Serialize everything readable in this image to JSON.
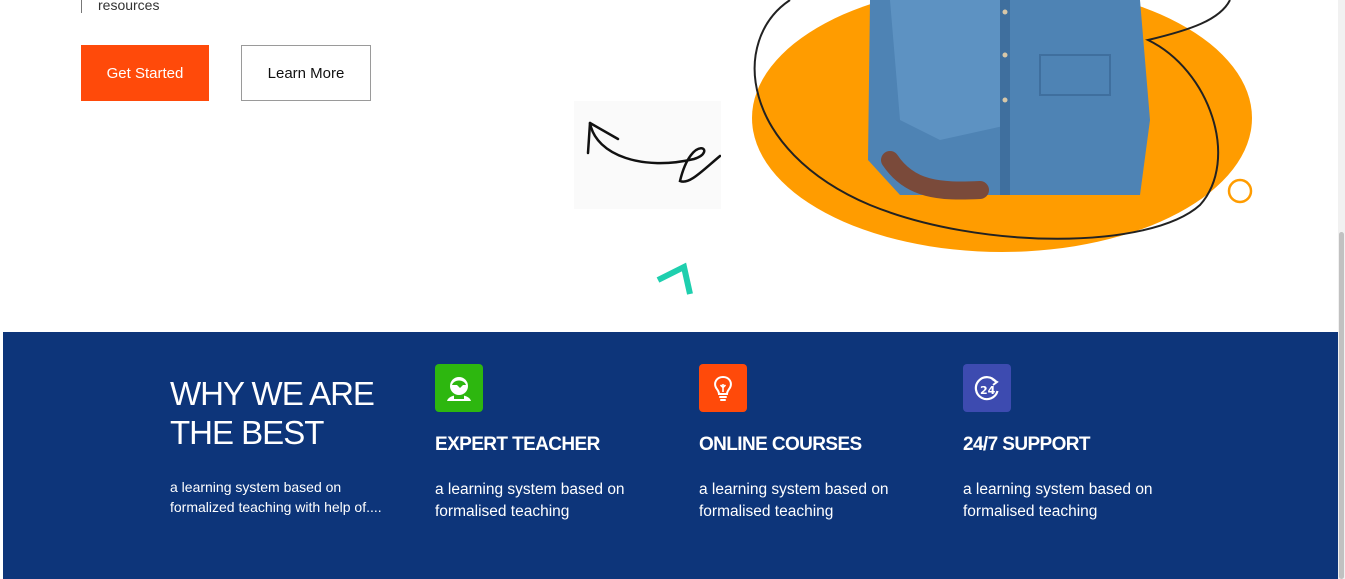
{
  "hero": {
    "bullet_text": "resources",
    "get_started_label": "Get Started",
    "learn_more_label": "Learn More"
  },
  "features_section": {
    "title_line1": "WHY WE ARE",
    "title_line2": "THE BEST",
    "description": "a learning system based on formalized teaching with help of....",
    "items": [
      {
        "title": "EXPERT TEACHER",
        "description": "a learning system based on formalised teaching",
        "icon": "teacher-icon",
        "color": "#2db70f"
      },
      {
        "title": "ONLINE COURSES",
        "description": "a learning system based on formalised teaching",
        "icon": "lightbulb-icon",
        "color": "#ff4a0a"
      },
      {
        "title": "24/7 SUPPORT",
        "description": "a learning system based on formalised teaching",
        "icon": "support-24-icon",
        "color": "#3d4bb0"
      }
    ]
  },
  "colors": {
    "accent": "#ff4a0a",
    "section_bg": "#0d357a",
    "blob": "#ff9c00",
    "teal": "#1ecfae"
  }
}
